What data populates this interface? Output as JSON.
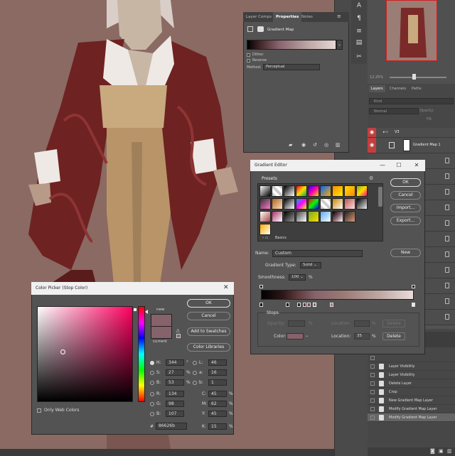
{
  "colors": {
    "canvas_bg": "#8a6a63",
    "selected_stop": "#86626b",
    "layer_eye": "#c04040"
  },
  "panels": {
    "layers_tab": "Layers",
    "channels_tab": "Channels",
    "paths_tab": "Paths",
    "kind_filter": "Kind",
    "blend_mode": "Normal",
    "opacity_label": "Opacity:",
    "fill_label": "Fill:",
    "group_name": "V3",
    "gradient_layer": "Gradient Map 1",
    "zoom": "12.25%"
  },
  "history": {
    "items": [
      "Layer Visibility",
      "Layer Visibility",
      "Delete Layer",
      "Crop",
      "New Gradient Map Layer",
      "Modify Gradient Map Layer",
      "Modify Gradient Map Layer"
    ]
  },
  "properties": {
    "tab1": "Layer Comps",
    "tab2": "Properties",
    "tab3": "Notes",
    "heading": "Gradient Map",
    "dither": "Dither",
    "reverse": "Reverse",
    "method_label": "Method:",
    "method_value": "Perceptual"
  },
  "gradient_editor": {
    "title": "Gradient Editor",
    "presets_label": "Presets",
    "basics_label": "Basics",
    "ok": "OK",
    "cancel": "Cancel",
    "import": "Import...",
    "export": "Export...",
    "name_label": "Name:",
    "name_value": "Custom",
    "new": "New",
    "gradient_type_label": "Gradient Type:",
    "gradient_type_value": "Solid",
    "smoothness_label": "Smoothness:",
    "smoothness_value": "100",
    "percent": "%",
    "stops_label": "Stops",
    "opacity_label": "Opacity:",
    "location_label": "Location:",
    "delete": "Delete",
    "color_label": "Color:",
    "location_value": "35"
  },
  "color_picker": {
    "title": "Color Picker (Stop Color)",
    "new_label": "new",
    "current_label": "current",
    "ok": "OK",
    "cancel": "Cancel",
    "add_swatches": "Add to Swatches",
    "libraries": "Color Libraries",
    "only_web": "Only Web Colors",
    "H": "344",
    "S": "27",
    "B": "53",
    "R": "134",
    "G": "98",
    "Bv": "107",
    "L": "46",
    "a": "16",
    "b": "1",
    "C": "45",
    "M": "62",
    "Y": "45",
    "K": "15",
    "hex": "86626b",
    "deg": "°",
    "pct": "%",
    "hash": "#"
  }
}
